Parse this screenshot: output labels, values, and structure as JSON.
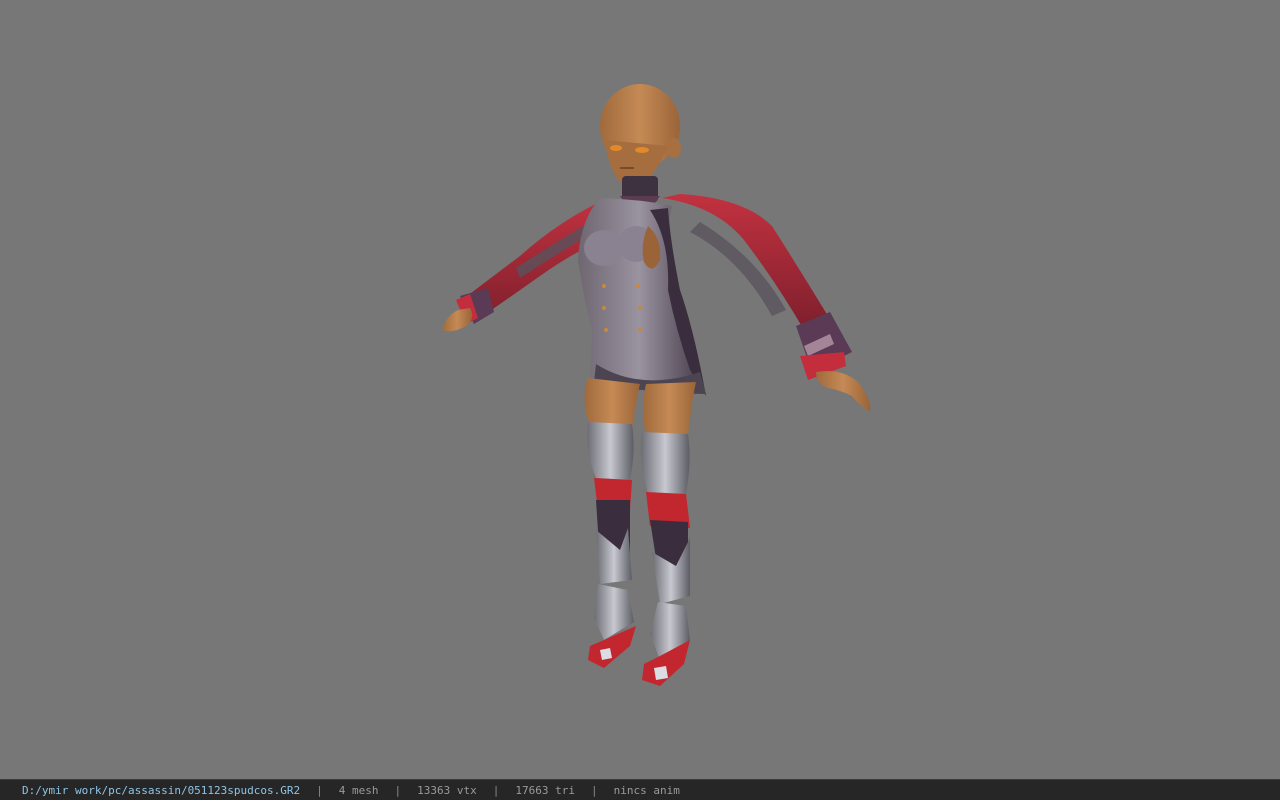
{
  "viewport": {
    "background_color": "#777777",
    "model_icon": "character-model-tpose"
  },
  "status_bar": {
    "file_path": "D:/ymir work/pc/assassin/051123spudcos.GR2",
    "separator": "|",
    "mesh_count": "4 mesh",
    "vertex_count": "13363 vtx",
    "triangle_count": "17663 tri",
    "anim_status": "nincs anim",
    "path_color": "#8fc4e6",
    "text_color": "#9a9a9a"
  }
}
